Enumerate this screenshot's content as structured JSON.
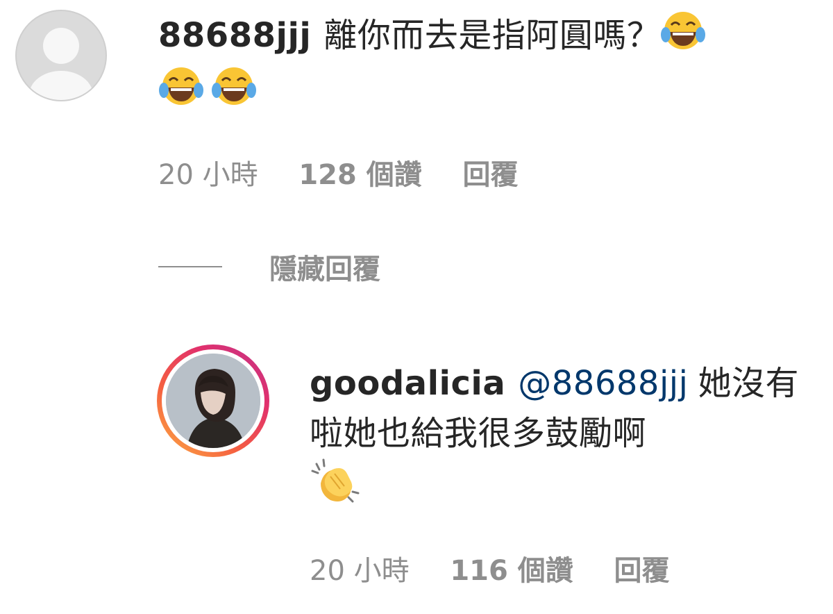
{
  "comments": [
    {
      "username": "88688jjj",
      "text": "離你而去是指阿圓嗎？",
      "emojis": [
        "face-with-tears-of-joy",
        "face-with-tears-of-joy",
        "face-with-tears-of-joy"
      ],
      "time": "20 小時",
      "likes": "128 個讚",
      "reply_label": "回覆",
      "avatar": "default-avatar"
    },
    {
      "username": "goodalicia",
      "mention": "@88688jjj",
      "text": "她沒有啦她也給我很多鼓勵啊",
      "emojis": [
        "clapping-hands"
      ],
      "time": "20 小時",
      "likes": "116 個讚",
      "reply_label": "回覆",
      "avatar": "story-ring-photo"
    }
  ],
  "hide_replies_label": "隱藏回覆",
  "colors": {
    "text": "#262626",
    "muted": "#8e8e8e",
    "mention": "#00376b",
    "ring_start": "#c1358a",
    "ring_end": "#fcaf45"
  }
}
